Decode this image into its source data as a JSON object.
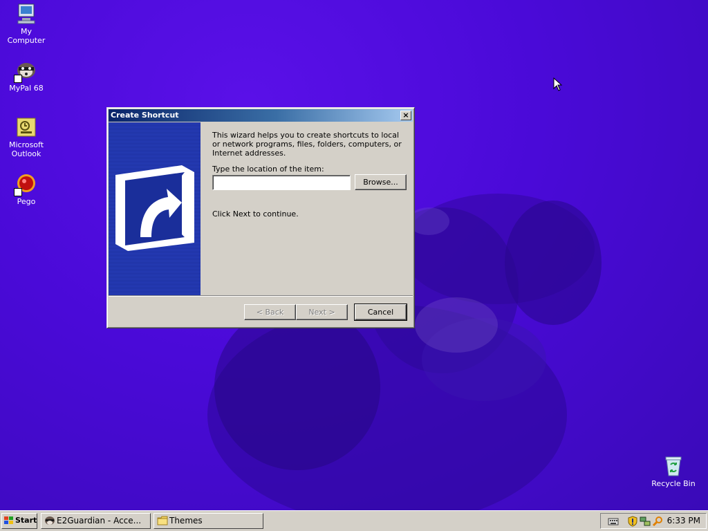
{
  "desktop": {
    "icons": [
      {
        "label": "My Computer"
      },
      {
        "label": "MyPal 68"
      },
      {
        "label": "Microsoft Outlook"
      },
      {
        "label": "Pego"
      },
      {
        "label": "Recycle Bin"
      }
    ]
  },
  "dialog": {
    "title": "Create Shortcut",
    "close_label": "×",
    "intro": "This wizard helps you to create shortcuts to local or network programs, files, folders, computers, or Internet addresses.",
    "location_label": "Type the location of the item:",
    "location_value": "",
    "browse_label": "Browse...",
    "continue_text": "Click Next to continue.",
    "back_label": "< Back",
    "next_label": "Next >",
    "cancel_label": "Cancel"
  },
  "taskbar": {
    "start_label": "Start",
    "tasks": [
      {
        "label": "E2Guardian - Acce...",
        "icon": "browser-icon"
      },
      {
        "label": "Themes",
        "icon": "folder-icon"
      }
    ],
    "clock": "6:33 PM",
    "tray_icons": [
      "keyboard-icon",
      "shield-icon",
      "network-icon",
      "search-icon"
    ]
  },
  "colors": {
    "desktop": "#4a0ad8",
    "title_active": "#0a246a",
    "face": "#d4d0c8"
  }
}
